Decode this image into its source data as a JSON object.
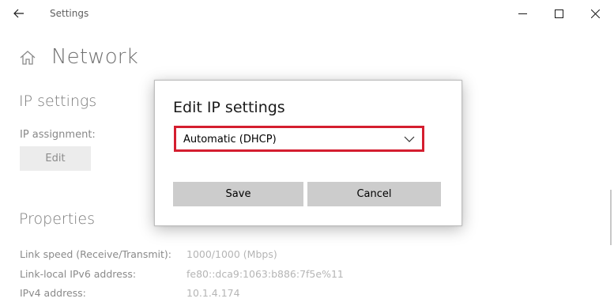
{
  "window": {
    "title": "Settings",
    "controls": {
      "minimize": "minimize-icon",
      "maximize": "maximize-icon",
      "close": "close-icon"
    }
  },
  "page": {
    "title": "Network",
    "ip_section": {
      "heading": "IP settings",
      "assignment_label": "IP assignment:",
      "edit_label": "Edit"
    },
    "properties": {
      "heading": "Properties",
      "rows": [
        {
          "label": "Link speed (Receive/Transmit):",
          "value": "1000/1000 (Mbps)"
        },
        {
          "label": "Link-local IPv6 address:",
          "value": "fe80::dca9:1063:b886:7f5e%11"
        },
        {
          "label": "IPv4 address:",
          "value": "10.1.4.174"
        }
      ]
    }
  },
  "dialog": {
    "title": "Edit IP settings",
    "select": {
      "value": "Automatic (DHCP)",
      "highlight_color": "#d41e2f"
    },
    "save_label": "Save",
    "cancel_label": "Cancel"
  }
}
